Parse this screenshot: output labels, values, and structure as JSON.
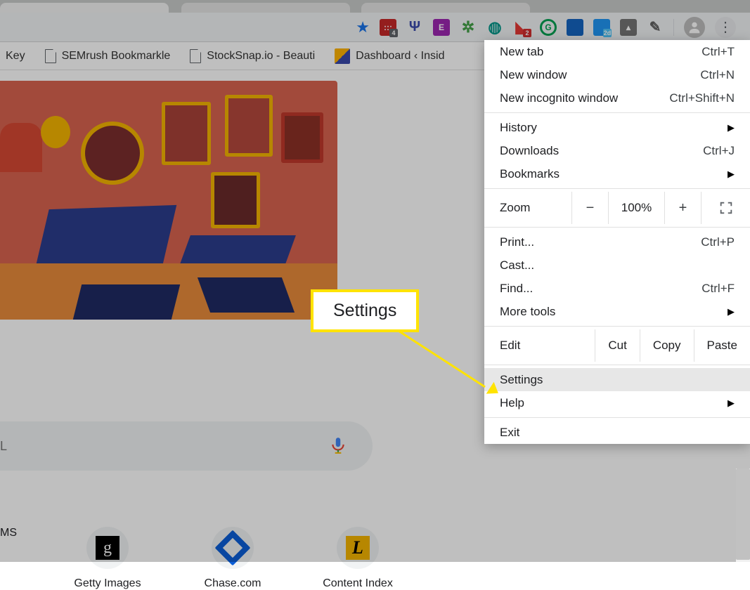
{
  "bookmarks": [
    {
      "label": "Key"
    },
    {
      "label": "SEMrush Bookmarkle"
    },
    {
      "label": "StockSnap.io - Beauti"
    },
    {
      "label": "Dashboard ‹ Insid"
    }
  ],
  "extensions": [
    {
      "color": "#c62828",
      "badge": "4"
    },
    {
      "color": "#3f51b5",
      "glyph": "Y"
    },
    {
      "color": "#9c27b0",
      "glyph": "E"
    },
    {
      "color": "#43a047",
      "glyph": "❋"
    },
    {
      "color": "#009688",
      "glyph": "O"
    },
    {
      "color": "#e53935",
      "glyph": "",
      "badge": "2"
    },
    {
      "color": "#00a152",
      "glyph": "G"
    },
    {
      "color": "#1565c0",
      "glyph": ""
    },
    {
      "color": "#2196f3",
      "glyph": "",
      "badge": "2d"
    },
    {
      "color": "#5d4037",
      "glyph": "▲"
    },
    {
      "color": "#9e9e9e",
      "glyph": "✎"
    }
  ],
  "shortcuts_partial": "MS",
  "shortcuts": [
    {
      "label": "Getty Images",
      "iconClass": "g",
      "iconGlyph": "g"
    },
    {
      "label": "Chase.com",
      "iconClass": "chase",
      "iconGlyph": ""
    },
    {
      "label": "Content Index",
      "iconClass": "l",
      "iconGlyph": "L"
    }
  ],
  "search": {
    "placeholder": "L"
  },
  "menu": {
    "newTab": {
      "label": "New tab",
      "shortcut": "Ctrl+T"
    },
    "newWindow": {
      "label": "New window",
      "shortcut": "Ctrl+N"
    },
    "newIncognito": {
      "label": "New incognito window",
      "shortcut": "Ctrl+Shift+N"
    },
    "history": {
      "label": "History"
    },
    "downloads": {
      "label": "Downloads",
      "shortcut": "Ctrl+J"
    },
    "bookmarks": {
      "label": "Bookmarks"
    },
    "zoom": {
      "label": "Zoom",
      "value": "100%",
      "minus": "−",
      "plus": "+"
    },
    "print": {
      "label": "Print...",
      "shortcut": "Ctrl+P"
    },
    "cast": {
      "label": "Cast..."
    },
    "find": {
      "label": "Find...",
      "shortcut": "Ctrl+F"
    },
    "moreTools": {
      "label": "More tools"
    },
    "edit": {
      "label": "Edit",
      "cut": "Cut",
      "copy": "Copy",
      "paste": "Paste"
    },
    "settings": {
      "label": "Settings"
    },
    "help": {
      "label": "Help"
    },
    "exit": {
      "label": "Exit"
    }
  },
  "callout": {
    "label": "Settings"
  }
}
